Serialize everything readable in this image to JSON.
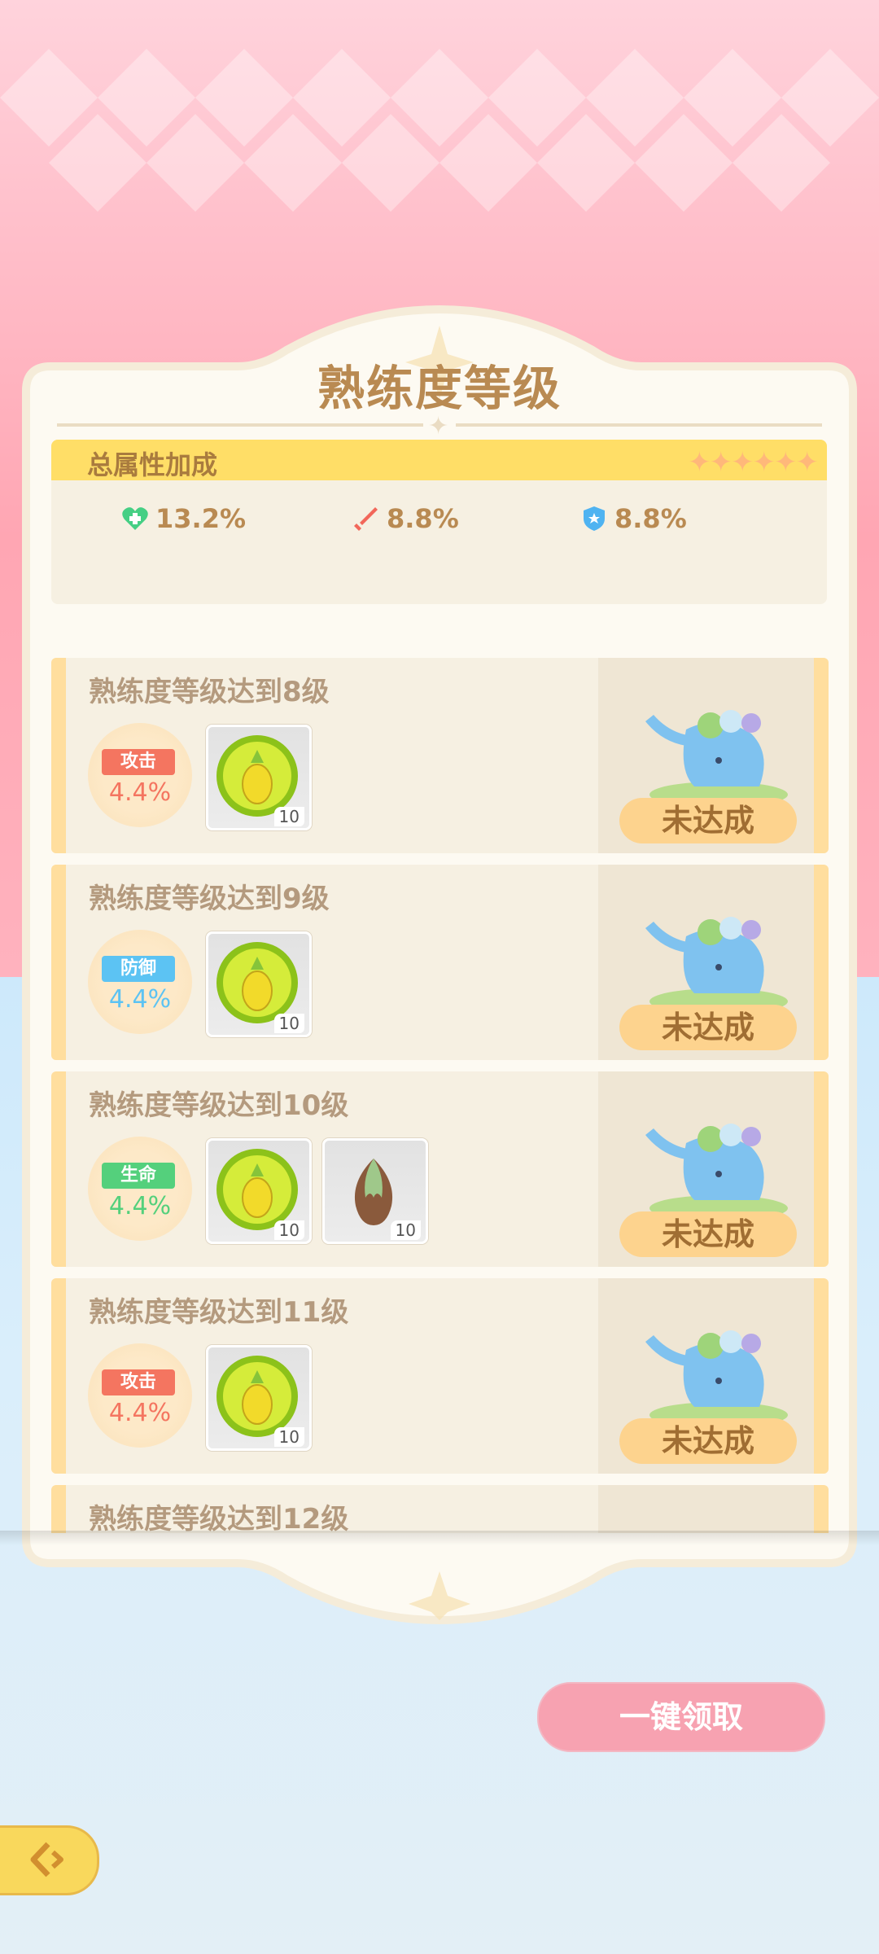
{
  "page": {
    "title": "熟练度等级",
    "claim_all_label": "一键领取"
  },
  "total_attributes": {
    "label": "总属性加成",
    "stars": "✦✦✦✦✦✦",
    "items": [
      {
        "icon": "health-heart-icon",
        "value": "13.2%"
      },
      {
        "icon": "attack-sword-icon",
        "value": "8.8%"
      },
      {
        "icon": "defense-shield-icon",
        "value": "8.8%"
      }
    ]
  },
  "colors": {
    "attack": "#f47560",
    "defense": "#5cc3f3",
    "life": "#54d07c",
    "status_button": "#fdd38e"
  },
  "milestones": [
    {
      "title": "熟练度等级达到8级",
      "bonus_tag": "攻击",
      "bonus_value": "4.4%",
      "bonus_type": "attack",
      "items": [
        {
          "icon": "pineapple-coin-icon",
          "count": "10"
        }
      ],
      "status": "未达成"
    },
    {
      "title": "熟练度等级达到9级",
      "bonus_tag": "防御",
      "bonus_value": "4.4%",
      "bonus_type": "defense",
      "items": [
        {
          "icon": "pineapple-coin-icon",
          "count": "10"
        }
      ],
      "status": "未达成"
    },
    {
      "title": "熟练度等级达到10级",
      "bonus_tag": "生命",
      "bonus_value": "4.4%",
      "bonus_type": "life",
      "items": [
        {
          "icon": "pineapple-coin-icon",
          "count": "10"
        },
        {
          "icon": "seed-icon",
          "count": "10"
        }
      ],
      "status": "未达成"
    },
    {
      "title": "熟练度等级达到11级",
      "bonus_tag": "攻击",
      "bonus_value": "4.4%",
      "bonus_type": "attack",
      "items": [
        {
          "icon": "pineapple-coin-icon",
          "count": "10"
        }
      ],
      "status": "未达成"
    },
    {
      "title": "熟练度等级达到12级",
      "bonus_tag": "",
      "bonus_value": "",
      "bonus_type": "",
      "items": [],
      "status": ""
    }
  ]
}
